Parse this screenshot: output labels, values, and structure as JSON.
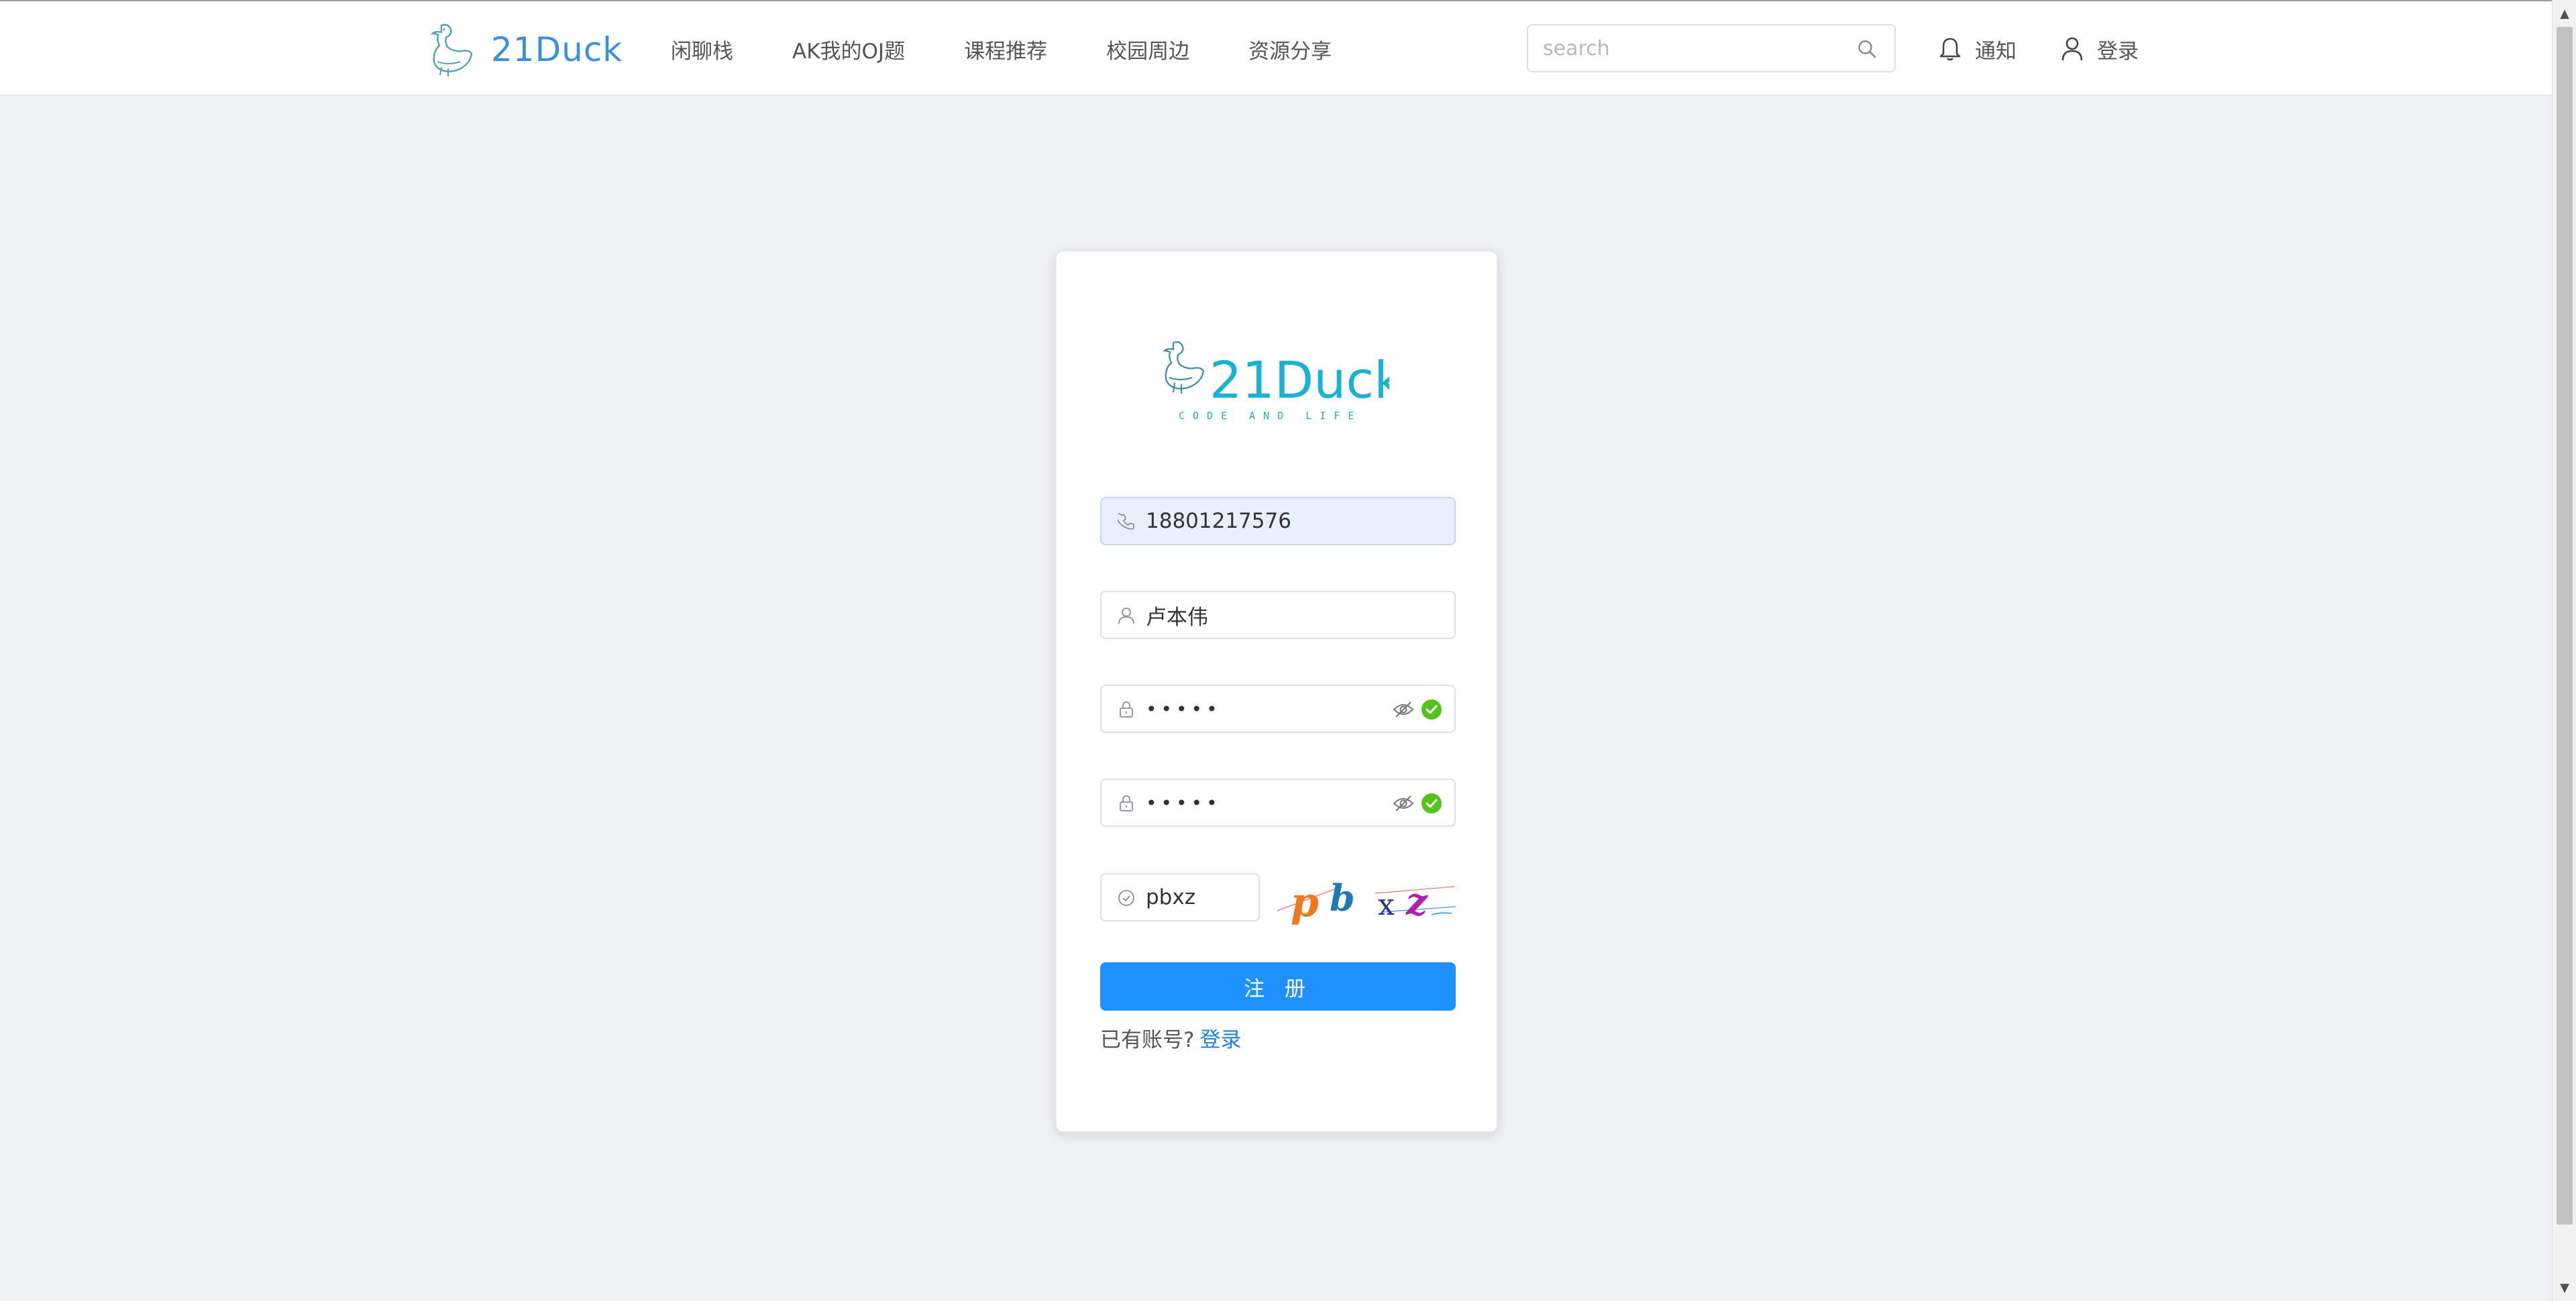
{
  "header": {
    "brand": "21Duck",
    "nav": [
      {
        "label": "闲聊栈"
      },
      {
        "label": "AK我的OJ题"
      },
      {
        "label": "课程推荐"
      },
      {
        "label": "校园周边"
      },
      {
        "label": "资源分享"
      }
    ],
    "search_placeholder": "search",
    "notify_label": "通知",
    "login_label": "登录"
  },
  "register": {
    "logo_text": "21Duck",
    "logo_tagline": "CODE AND LIFE",
    "phone_value": "18801217576",
    "name_value": "卢本伟",
    "password_value": "•••••",
    "confirm_value": "•••••",
    "captcha_value": "pbxz",
    "captcha_chars": [
      "p",
      "b",
      "x",
      "z"
    ],
    "submit_label": "注 册",
    "have_account_text": "已有账号?",
    "login_link": "登录"
  },
  "colors": {
    "brand_blue": "#3a8fe3",
    "primary_button": "#1e90ff",
    "success_green": "#52c41a",
    "logo_teal": "#17b3d6",
    "page_bg": "#eff0f4"
  },
  "icons": [
    "duck-logo-icon",
    "search-icon",
    "bell-icon",
    "user-icon",
    "phone-icon",
    "lock-icon",
    "eye-off-icon",
    "check-circle-icon"
  ]
}
